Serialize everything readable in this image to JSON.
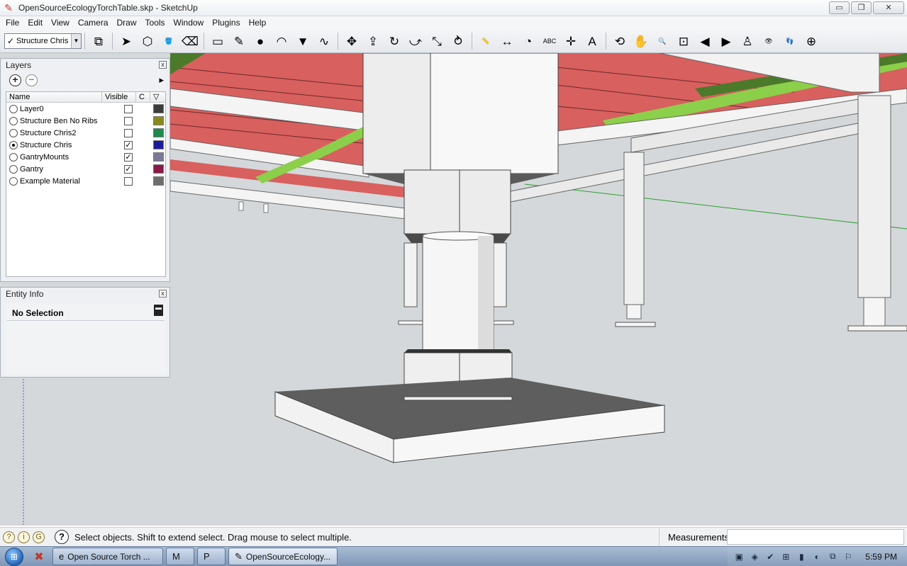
{
  "window": {
    "title": "OpenSourceEcologyTorchTable.skp - SketchUp",
    "minimize_label": "▭",
    "restore_label": "❐",
    "close_label": "✕"
  },
  "menu": [
    "File",
    "Edit",
    "View",
    "Camera",
    "Draw",
    "Tools",
    "Window",
    "Plugins",
    "Help"
  ],
  "toolbar": {
    "layer_select_value": "Structure Chris",
    "tools": [
      {
        "name": "layer-manager-icon",
        "glyph": "⧉"
      },
      {
        "name": "select-arrow-icon",
        "glyph": "➤"
      },
      {
        "name": "make-component-icon",
        "glyph": "⬡"
      },
      {
        "name": "paint-bucket-icon",
        "glyph": "🪣"
      },
      {
        "name": "eraser-icon",
        "glyph": "⌫"
      },
      {
        "name": "rectangle-icon",
        "glyph": "▭"
      },
      {
        "name": "line-pencil-icon",
        "glyph": "✎"
      },
      {
        "name": "circle-icon",
        "glyph": "●"
      },
      {
        "name": "arc-icon",
        "glyph": "◠"
      },
      {
        "name": "polygon-icon",
        "glyph": "▼"
      },
      {
        "name": "freehand-icon",
        "glyph": "∿"
      },
      {
        "name": "move-icon",
        "glyph": "✥"
      },
      {
        "name": "push-pull-icon",
        "glyph": "⇪"
      },
      {
        "name": "rotate-icon",
        "glyph": "↻"
      },
      {
        "name": "follow-me-icon",
        "glyph": "⤻"
      },
      {
        "name": "scale-icon",
        "glyph": "⤡"
      },
      {
        "name": "offset-icon",
        "glyph": "⥁"
      },
      {
        "name": "tape-measure-icon",
        "glyph": "📏"
      },
      {
        "name": "dimension-icon",
        "glyph": "↔"
      },
      {
        "name": "protractor-icon",
        "glyph": "◔"
      },
      {
        "name": "text-label-icon",
        "glyph": "ABC"
      },
      {
        "name": "axes-icon",
        "glyph": "✛"
      },
      {
        "name": "3d-text-icon",
        "glyph": "A"
      },
      {
        "name": "orbit-icon",
        "glyph": "⟲"
      },
      {
        "name": "pan-hand-icon",
        "glyph": "✋"
      },
      {
        "name": "zoom-icon",
        "glyph": "🔍"
      },
      {
        "name": "zoom-window-icon",
        "glyph": "⊡"
      },
      {
        "name": "previous-view-icon",
        "glyph": "◀"
      },
      {
        "name": "next-view-icon",
        "glyph": "▶"
      },
      {
        "name": "position-camera-icon",
        "glyph": "♙"
      },
      {
        "name": "look-around-icon",
        "glyph": "👁"
      },
      {
        "name": "walk-icon",
        "glyph": "👣"
      },
      {
        "name": "section-plane-icon",
        "glyph": "⊕"
      }
    ]
  },
  "layers_panel": {
    "title": "Layers",
    "close_label": "x",
    "add_label": "+",
    "remove_label": "−",
    "details_label": "▸",
    "columns": {
      "name": "Name",
      "visible": "Visible",
      "color": "C",
      "sort": "▽"
    },
    "rows": [
      {
        "name": "Layer0",
        "active": false,
        "visible": false,
        "color": "#3b3b3b"
      },
      {
        "name": "Structure Ben No Ribs",
        "active": false,
        "visible": false,
        "color": "#8a8a1a"
      },
      {
        "name": "Structure Chris2",
        "active": false,
        "visible": false,
        "color": "#1f8a4c"
      },
      {
        "name": "Structure Chris",
        "active": true,
        "visible": true,
        "color": "#1c1c9a"
      },
      {
        "name": "GantryMounts",
        "active": false,
        "visible": true,
        "color": "#7a7a98"
      },
      {
        "name": "Gantry",
        "active": false,
        "visible": true,
        "color": "#8a1848"
      },
      {
        "name": "Example Material",
        "active": false,
        "visible": false,
        "color": "#6e6e6e"
      }
    ]
  },
  "entity_panel": {
    "title": "Entity Info",
    "close_label": "x",
    "selection": "No Selection",
    "toggle_label": "▬"
  },
  "statusbar": {
    "icons": [
      {
        "name": "geo-location-icon",
        "glyph": "?"
      },
      {
        "name": "credits-icon",
        "glyph": "i"
      },
      {
        "name": "user-icon",
        "glyph": "G"
      }
    ],
    "help_label": "?",
    "message": "Select objects. Shift to extend select. Drag mouse to select multiple.",
    "measurements_label": "Measurements",
    "measurements_value": ""
  },
  "taskbar": {
    "start_label": "⊞",
    "quick": [
      {
        "name": "taskbar-app-icon",
        "glyph": "✖"
      }
    ],
    "tasks": [
      {
        "name": "task-browser",
        "icon": "e",
        "label": "Open Source Torch ...",
        "width": 156,
        "active": false
      },
      {
        "name": "task-mail",
        "icon": "M",
        "label": "",
        "width": 40,
        "active": false
      },
      {
        "name": "task-publisher",
        "icon": "P",
        "label": "",
        "width": 40,
        "active": false
      },
      {
        "name": "task-sketchup",
        "icon": "✎",
        "label": "OpenSourceEcology...",
        "width": 154,
        "active": true
      }
    ],
    "tray_icons": [
      "▣",
      "◈",
      "✔",
      "⊞",
      "▮",
      "◐",
      "⧉",
      "⚐"
    ],
    "clock": "5:59 PM"
  }
}
